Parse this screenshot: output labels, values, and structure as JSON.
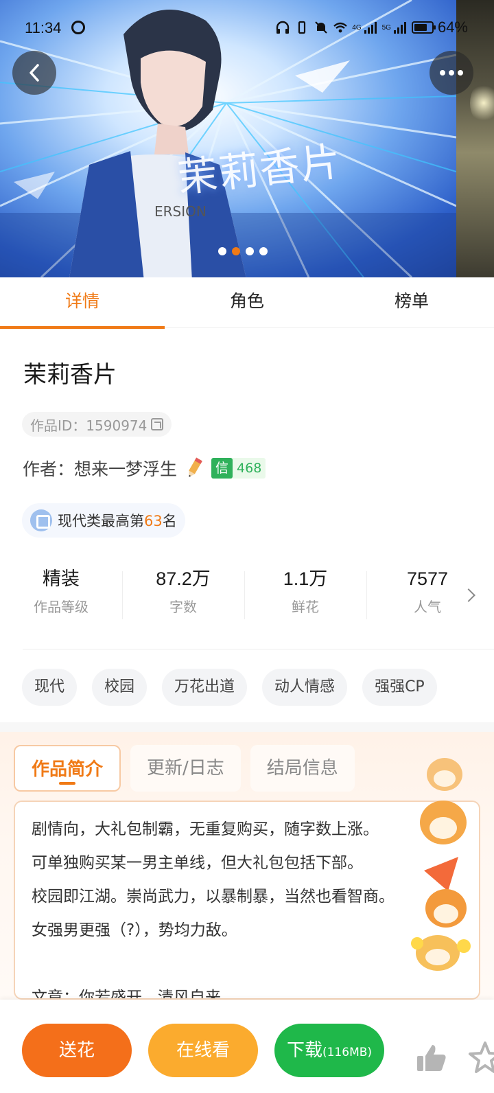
{
  "status_bar": {
    "time": "11:34",
    "signal_4g": "4G",
    "signal_5g": "5G",
    "battery": "64%"
  },
  "banner": {
    "title_art": "茉莉香片",
    "slide_count": 4,
    "active_slide": 2
  },
  "tabs": [
    {
      "label": "详情",
      "active": true
    },
    {
      "label": "角色",
      "active": false
    },
    {
      "label": "榜单",
      "active": false
    }
  ],
  "work": {
    "title": "茉莉香片",
    "id_text": "作品ID：1590974",
    "author_text": "作者：想来一梦浮生",
    "trust_label": "信",
    "trust_count": "468",
    "rank_prefix": "现代类最高第",
    "rank_number": "63",
    "rank_suffix": "名"
  },
  "stats": [
    {
      "value": "精装",
      "label": "作品等级"
    },
    {
      "value": "87.2万",
      "label": "字数"
    },
    {
      "value": "1.1万",
      "label": "鲜花"
    },
    {
      "value": "7577",
      "label": "人气"
    }
  ],
  "tags": [
    "现代",
    "校园",
    "万花出道",
    "动人情感",
    "强强CP"
  ],
  "sub_tabs": [
    {
      "label": "作品简介",
      "active": true
    },
    {
      "label": "更新/日志",
      "active": false
    },
    {
      "label": "结局信息",
      "active": false
    }
  ],
  "intro_lines": [
    "剧情向，大礼包制霸，无重复购买，随字数上涨。",
    "可单独购买某一男主单线，但大礼包包括下部。",
    "校园即江湖。崇尚武力，以暴制暴，当然也看智商。",
    "女强男更强（?），势均力敌。",
    "",
    "文章：你若盛开，清风自来"
  ],
  "bottom_bar": {
    "flower_label": "送花",
    "online_label": "在线看",
    "download_label": "下载",
    "download_size": "(116MB)"
  },
  "colors": {
    "accent": "#f07a16",
    "green": "#1fb84a",
    "yellow": "#fbab2e"
  }
}
